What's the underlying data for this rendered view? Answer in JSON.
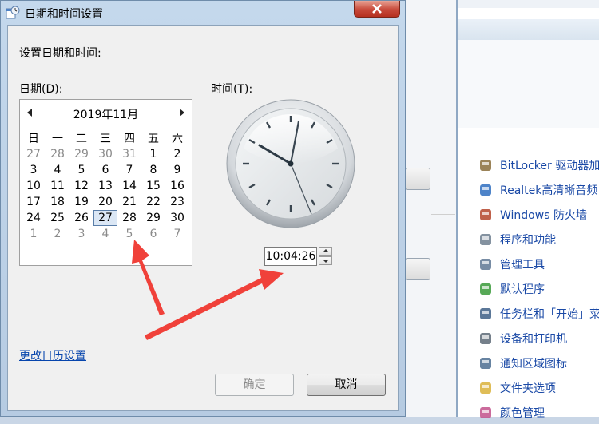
{
  "dialog": {
    "title": "日期和时间设置",
    "heading": "设置日期和时间:",
    "date_label": "日期(D):",
    "time_label": "时间(T):",
    "time_value": "10:04:26",
    "calendar_link": "更改日历设置",
    "ok_label": "确定",
    "cancel_label": "取消"
  },
  "calendar": {
    "month_title": "2019年11月",
    "weekdays": [
      "日",
      "一",
      "二",
      "三",
      "四",
      "五",
      "六"
    ],
    "weeks": [
      [
        "27",
        "28",
        "29",
        "30",
        "31",
        "1",
        "2"
      ],
      [
        "3",
        "4",
        "5",
        "6",
        "7",
        "8",
        "9"
      ],
      [
        "10",
        "11",
        "12",
        "13",
        "14",
        "15",
        "16"
      ],
      [
        "17",
        "18",
        "19",
        "20",
        "21",
        "22",
        "23"
      ],
      [
        "24",
        "25",
        "26",
        "27",
        "28",
        "29",
        "30"
      ],
      [
        "1",
        "2",
        "3",
        "4",
        "5",
        "6",
        "7"
      ]
    ],
    "selected_day": "27"
  },
  "control_panel": {
    "items": [
      {
        "label": "BitLocker 驱动器加",
        "icon": "key-icon"
      },
      {
        "label": "Realtek高清晰音频",
        "icon": "audio-icon"
      },
      {
        "label": "Windows 防火墙",
        "icon": "firewall-icon"
      },
      {
        "label": "程序和功能",
        "icon": "programs-icon"
      },
      {
        "label": "管理工具",
        "icon": "admin-tools-icon"
      },
      {
        "label": "默认程序",
        "icon": "default-programs-icon"
      },
      {
        "label": "任务栏和「开始」菜",
        "icon": "taskbar-icon"
      },
      {
        "label": "设备和打印机",
        "icon": "printer-icon"
      },
      {
        "label": "通知区域图标",
        "icon": "notification-icon"
      },
      {
        "label": "文件夹选项",
        "icon": "folder-icon"
      },
      {
        "label": "颜色管理",
        "icon": "color-icon"
      }
    ]
  },
  "colors": {
    "arrow": "#f0413a",
    "link": "#0645ad",
    "titlebar": "#c4d8ec"
  }
}
